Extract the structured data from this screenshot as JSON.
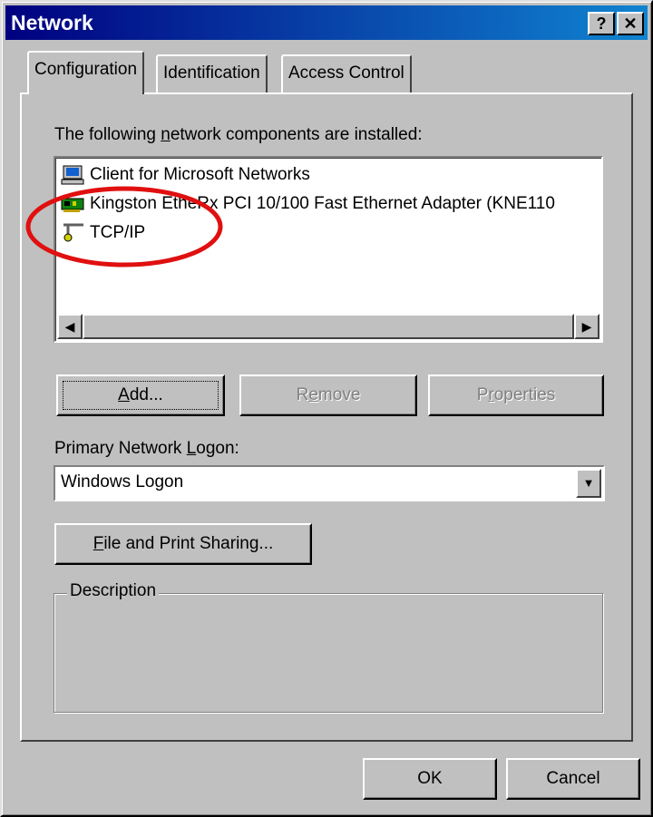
{
  "window": {
    "title": "Network"
  },
  "titlebar": {
    "help_glyph": "?",
    "close_glyph": "✕"
  },
  "tabs": [
    {
      "label": "Configuration",
      "selected": true
    },
    {
      "label": "Identification",
      "selected": false
    },
    {
      "label": "Access Control",
      "selected": false
    }
  ],
  "config": {
    "components_label_pre": "The following ",
    "components_label_key": "n",
    "components_label_post": "etwork components are installed:",
    "components": [
      {
        "label": "Client for Microsoft Networks",
        "icon": "network-client-icon"
      },
      {
        "label": "Kingston EtheRx PCI 10/100 Fast Ethernet Adapter (KNE110",
        "icon": "network-adapter-icon"
      },
      {
        "label": "TCP/IP",
        "icon": "protocol-icon"
      }
    ],
    "buttons": {
      "add_key": "A",
      "add_rest": "dd...",
      "remove_pre": "R",
      "remove_key": "e",
      "remove_post": "move",
      "properties_pre": "P",
      "properties_key": "r",
      "properties_post": "operties"
    },
    "logon_label_pre": "Primary Network ",
    "logon_label_key": "L",
    "logon_label_post": "ogon:",
    "logon_value": "Windows Logon",
    "sharing_key": "F",
    "sharing_rest": "ile and Print Sharing...",
    "description_title": "Description"
  },
  "footer": {
    "ok": "OK",
    "cancel": "Cancel"
  },
  "colors": {
    "face": "#c0c0c0",
    "title_active": "#000080",
    "annotation": "#e01010"
  }
}
